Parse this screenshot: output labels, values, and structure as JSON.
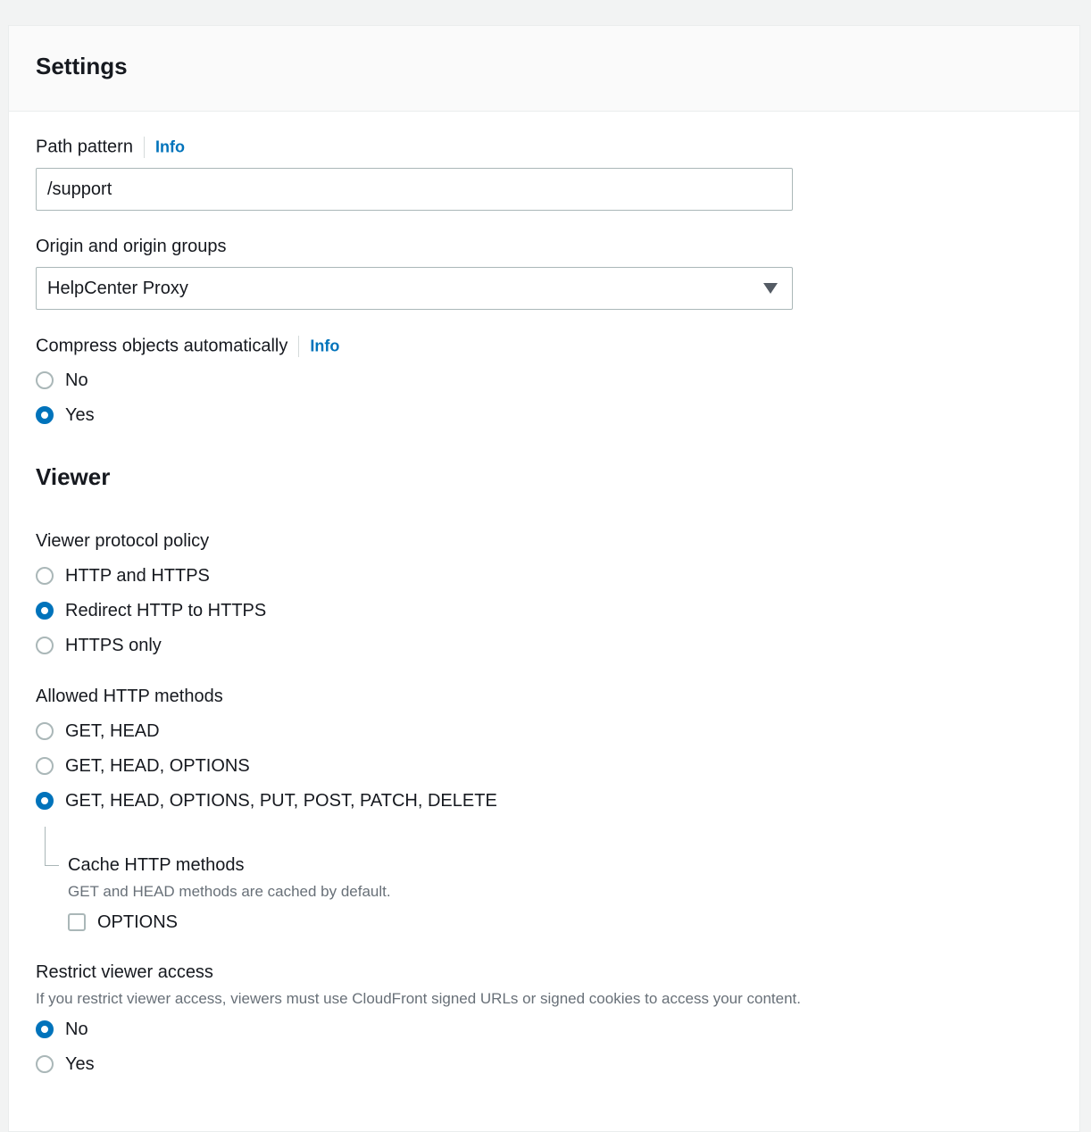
{
  "settings": {
    "title": "Settings",
    "path_pattern": {
      "label": "Path pattern",
      "info": "Info",
      "value": "/support"
    },
    "origin": {
      "label": "Origin and origin groups",
      "selected": "HelpCenter Proxy"
    },
    "compress": {
      "label": "Compress objects automatically",
      "info": "Info",
      "options": [
        {
          "label": "No",
          "checked": false
        },
        {
          "label": "Yes",
          "checked": true
        }
      ]
    }
  },
  "viewer": {
    "title": "Viewer",
    "protocol_policy": {
      "label": "Viewer protocol policy",
      "options": [
        {
          "label": "HTTP and HTTPS",
          "checked": false
        },
        {
          "label": "Redirect HTTP to HTTPS",
          "checked": true
        },
        {
          "label": "HTTPS only",
          "checked": false
        }
      ]
    },
    "allowed_methods": {
      "label": "Allowed HTTP methods",
      "options": [
        {
          "label": "GET, HEAD",
          "checked": false
        },
        {
          "label": "GET, HEAD, OPTIONS",
          "checked": false
        },
        {
          "label": "GET, HEAD, OPTIONS, PUT, POST, PATCH, DELETE",
          "checked": true
        }
      ]
    },
    "cache_methods": {
      "label": "Cache HTTP methods",
      "description": "GET and HEAD methods are cached by default.",
      "options_checkbox": {
        "label": "OPTIONS",
        "checked": false
      }
    },
    "restrict_access": {
      "label": "Restrict viewer access",
      "description": "If you restrict viewer access, viewers must use CloudFront signed URLs or signed cookies to access your content.",
      "options": [
        {
          "label": "No",
          "checked": true
        },
        {
          "label": "Yes",
          "checked": false
        }
      ]
    }
  },
  "colors": {
    "accent": "#0073bb",
    "text": "#16191f",
    "muted": "#687078",
    "border": "#aab7b8"
  }
}
